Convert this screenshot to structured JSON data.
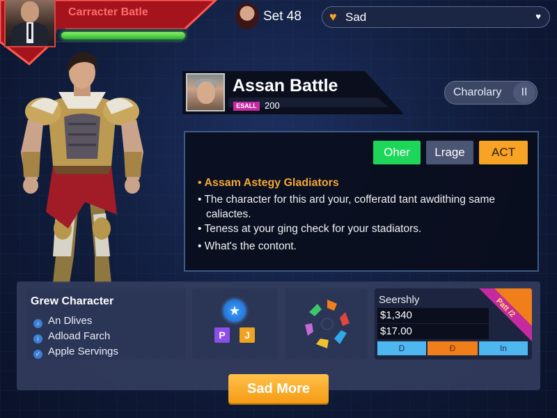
{
  "banner": {
    "title": "Carracter Batle"
  },
  "set": {
    "label": "Set 48"
  },
  "mode_select": {
    "value": "Sad",
    "icon": "heart-icon",
    "chevron": "chevron-down-icon"
  },
  "character": {
    "name": "Assan Battle",
    "tag": "ESALL",
    "value": "200"
  },
  "toggle": {
    "label": "Charolary",
    "pause_symbol": "II"
  },
  "info": {
    "buttons": {
      "oher": "Oher",
      "lrage": "Lrage",
      "act": "ACT"
    },
    "heading": "Assam Astegy Gladiators",
    "bullets": [
      "The character for this ard your, cofferatd tant awdithing same",
      "caliactes.",
      "Teness at your ging check for your stadiators.",
      "What's the contont."
    ]
  },
  "grew_card": {
    "title": "Grew Character",
    "items": [
      "An Dlives",
      "Adload Farch",
      "Apple Servings"
    ]
  },
  "badges": {
    "p": "P",
    "j": "J"
  },
  "seershly": {
    "title": "Seershly",
    "amounts": [
      "$1,340",
      "$17.00"
    ],
    "segments": [
      "D",
      "Đ",
      "In"
    ],
    "ribbon": "Patt /2"
  },
  "actions": {
    "send_more": "Sad More"
  },
  "colors": {
    "accent_red": "#e0453f",
    "health_green": "#2fb52f",
    "orange": "#f7a326",
    "green_button": "#1ed65a",
    "ribbon_pink": "#c62aa0"
  }
}
